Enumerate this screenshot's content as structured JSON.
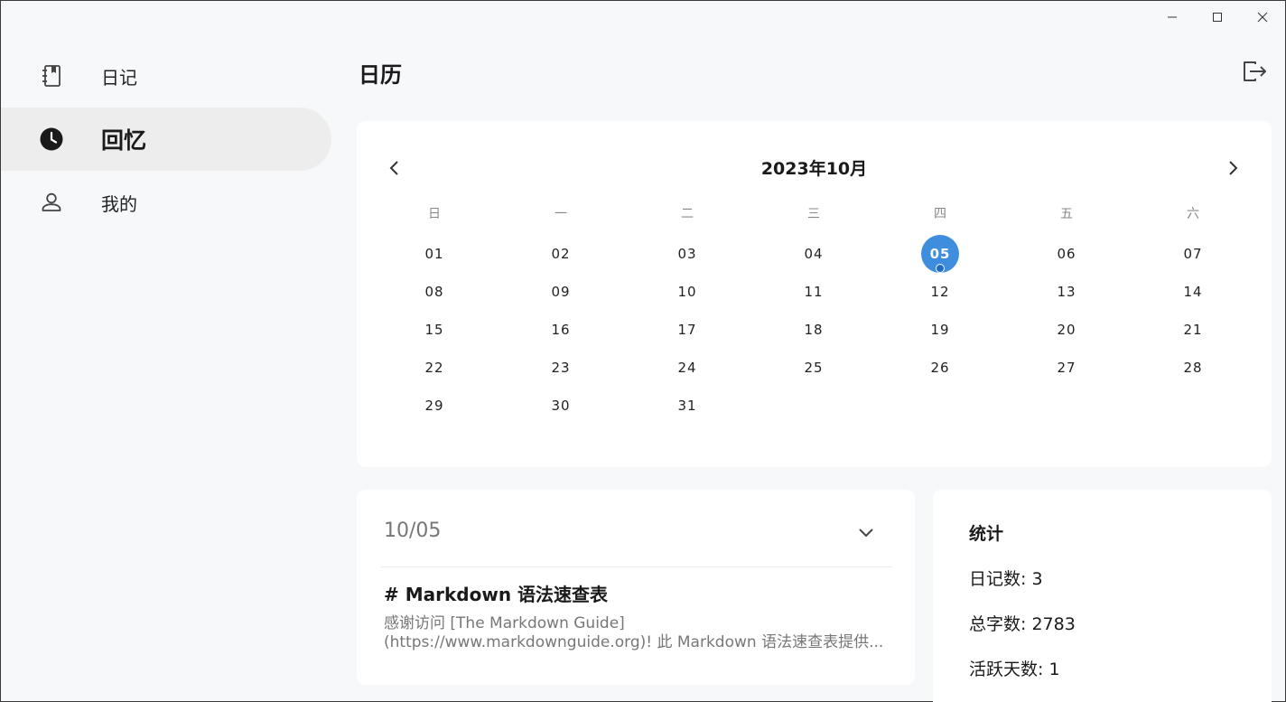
{
  "sidebar": {
    "items": [
      {
        "label": "日记",
        "icon": "notebook-icon"
      },
      {
        "label": "回忆",
        "icon": "clock-icon",
        "active": true
      },
      {
        "label": "我的",
        "icon": "person-icon"
      }
    ]
  },
  "header": {
    "title": "日历",
    "logout_icon": "logout-icon"
  },
  "calendar": {
    "month_label": "2023年10月",
    "weekdays": [
      "日",
      "一",
      "二",
      "三",
      "四",
      "五",
      "六"
    ],
    "selected_day": "05",
    "days": [
      "01",
      "02",
      "03",
      "04",
      "05",
      "06",
      "07",
      "08",
      "09",
      "10",
      "11",
      "12",
      "13",
      "14",
      "15",
      "16",
      "17",
      "18",
      "19",
      "20",
      "21",
      "22",
      "23",
      "24",
      "25",
      "26",
      "27",
      "28",
      "29",
      "30",
      "31"
    ],
    "colors": {
      "selected": "#3f8ede",
      "dot": "#1f6bc7"
    }
  },
  "entry": {
    "date": "10/05",
    "title": "# Markdown 语法速查表",
    "excerpt_line1": "感谢访问 [The Markdown Guide]",
    "excerpt_line2": "(https://www.markdownguide.org)! 此 Markdown 语法速查表提供..."
  },
  "stats": {
    "title": "统计",
    "diary_count": "日记数: 3",
    "word_count": "总字数: 2783",
    "active_days": "活跃天数: 1"
  }
}
